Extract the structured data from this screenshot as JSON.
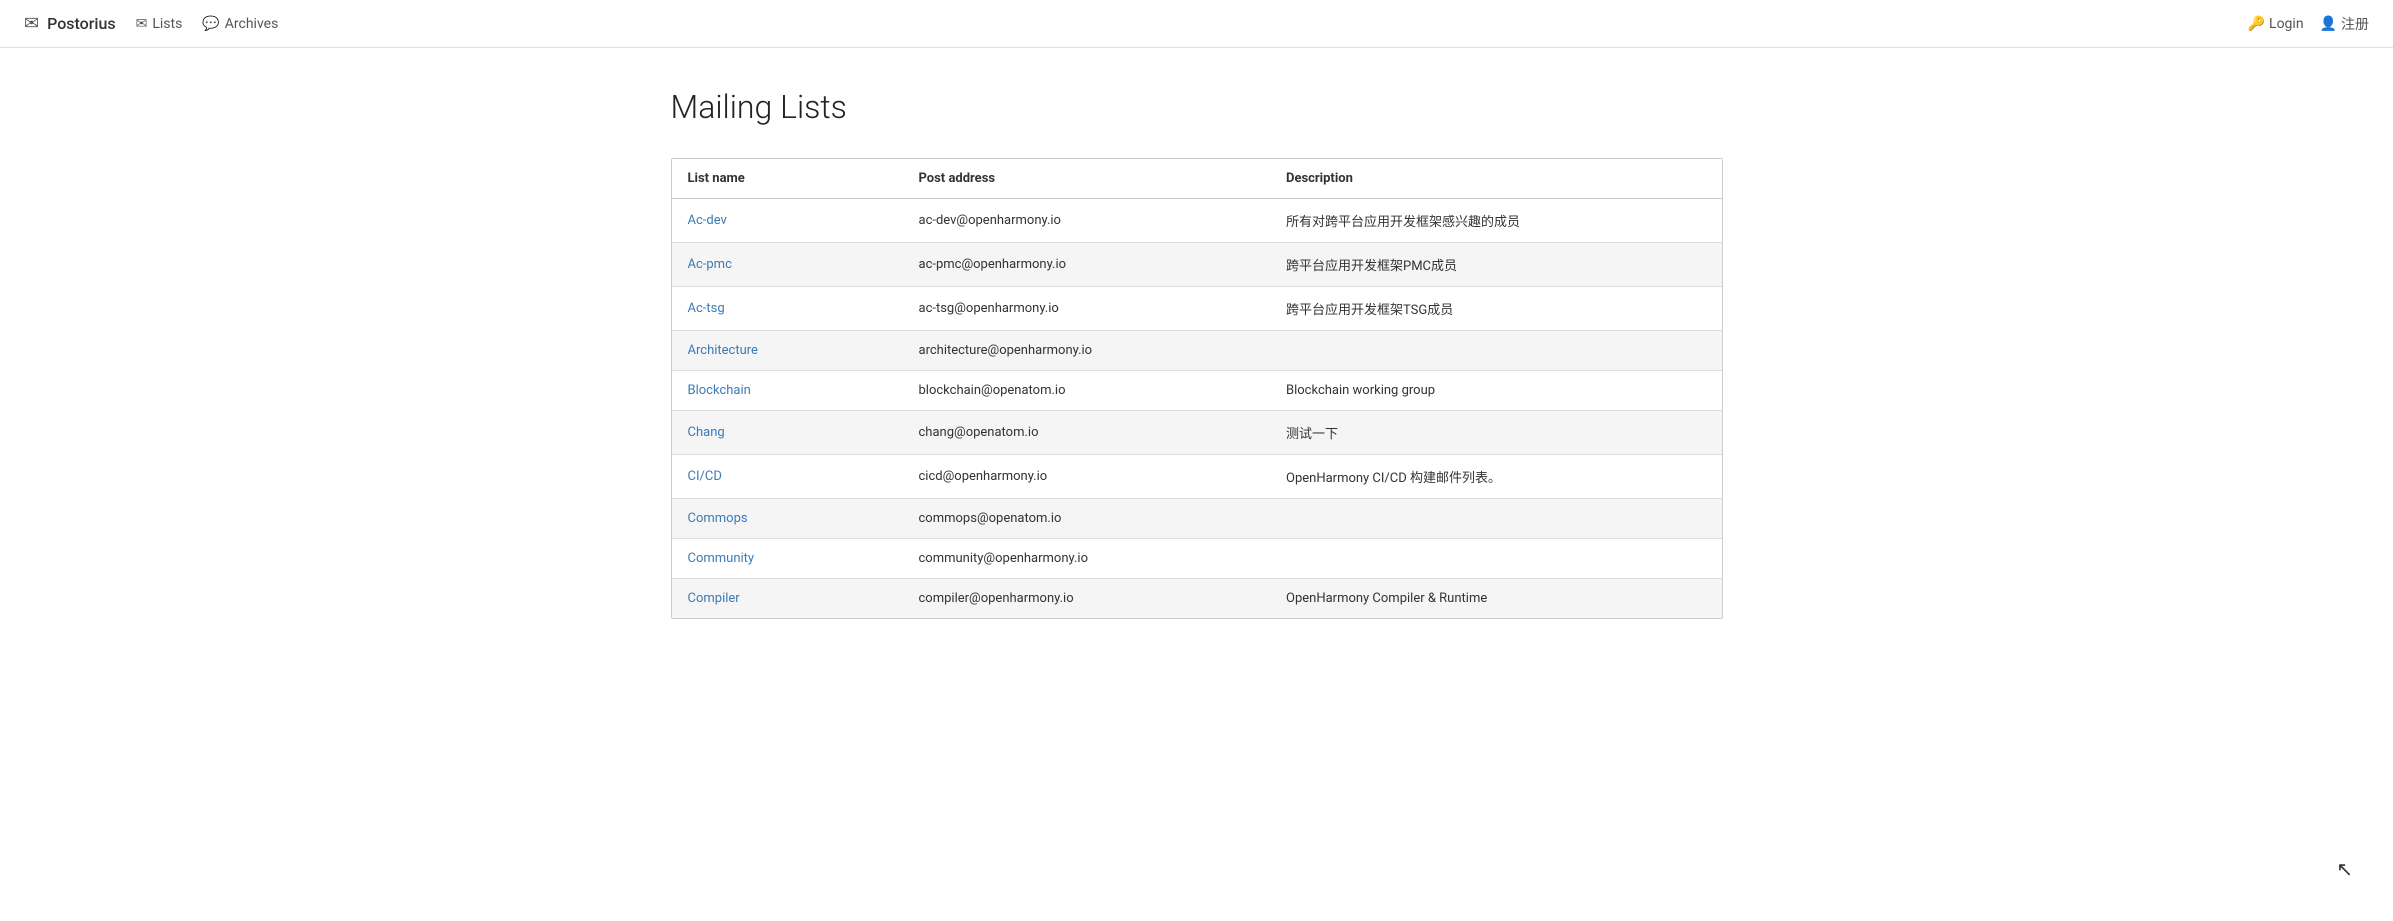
{
  "brand": {
    "logo_icon": "✉",
    "name": "Postorius"
  },
  "nav": {
    "lists_label": "Lists",
    "lists_icon": "✉",
    "archives_label": "Archives",
    "archives_icon": "💬"
  },
  "auth": {
    "login_label": "Login",
    "login_icon": "🔑",
    "register_label": "注册",
    "register_icon": "👤"
  },
  "main": {
    "page_title": "Mailing Lists"
  },
  "table": {
    "headers": {
      "list_name": "List name",
      "post_address": "Post address",
      "description": "Description"
    },
    "rows": [
      {
        "name": "Ac-dev",
        "post": "ac-dev@openharmony.io",
        "description": "所有对跨平台应用开发框架感兴趣的成员"
      },
      {
        "name": "Ac-pmc",
        "post": "ac-pmc@openharmony.io",
        "description": "跨平台应用开发框架PMC成员"
      },
      {
        "name": "Ac-tsg",
        "post": "ac-tsg@openharmony.io",
        "description": "跨平台应用开发框架TSG成员"
      },
      {
        "name": "Architecture",
        "post": "architecture@openharmony.io",
        "description": ""
      },
      {
        "name": "Blockchain",
        "post": "blockchain@openatom.io",
        "description": "Blockchain working group"
      },
      {
        "name": "Chang",
        "post": "chang@openatom.io",
        "description": "测试一下"
      },
      {
        "name": "CI/CD",
        "post": "cicd@openharmony.io",
        "description": "OpenHarmony CI/CD 构建邮件列表。"
      },
      {
        "name": "Commops",
        "post": "commops@openatom.io",
        "description": ""
      },
      {
        "name": "Community",
        "post": "community@openharmony.io",
        "description": ""
      },
      {
        "name": "Compiler",
        "post": "compiler@openharmony.io",
        "description": "OpenHarmony Compiler & Runtime"
      }
    ]
  }
}
